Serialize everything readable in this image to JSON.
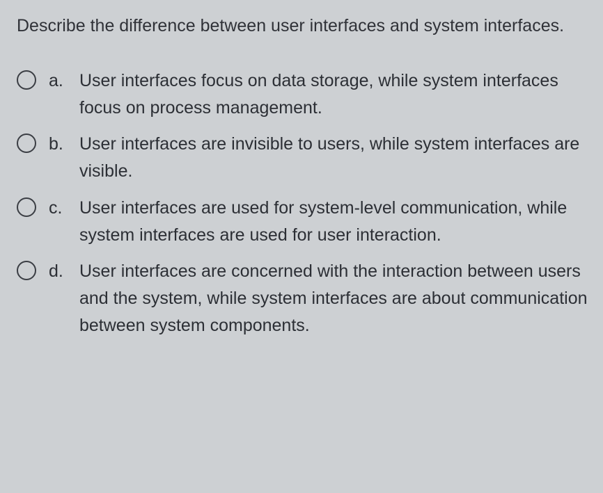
{
  "question": "Describe the difference between user interfaces and system interfaces.",
  "options": [
    {
      "letter": "a.",
      "text": "User interfaces focus on data storage, while system interfaces focus on process management."
    },
    {
      "letter": "b.",
      "text": "User interfaces are invisible to users, while system interfaces are visible."
    },
    {
      "letter": "c.",
      "text": "User interfaces are used for system-level communication, while system interfaces are used for user interaction."
    },
    {
      "letter": "d.",
      "text": "User interfaces are concerned with the interaction between users and the system, while system interfaces are about communication between system components."
    }
  ]
}
